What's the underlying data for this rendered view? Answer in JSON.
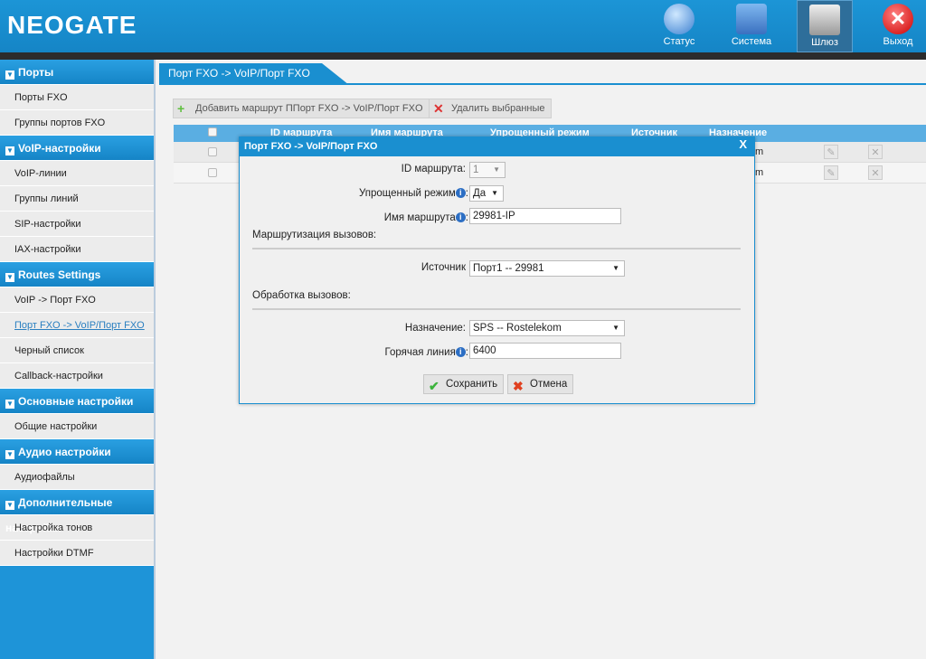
{
  "header": {
    "logo": "NEOGATE",
    "nav": [
      {
        "label": "Статус",
        "icon": "status-icon"
      },
      {
        "label": "Система",
        "icon": "system-icon"
      },
      {
        "label": "Шлюз",
        "icon": "gateway-icon",
        "active": true
      },
      {
        "label": "Выход",
        "icon": "logout-icon"
      }
    ]
  },
  "sidebar": {
    "sections": [
      {
        "title": "Порты",
        "items": [
          "Порты FXO",
          "Группы портов FXO"
        ]
      },
      {
        "title": "VoIP-настройки",
        "items": [
          "VoIP-линии",
          "Группы линий",
          "SIP-настройки",
          "IAX-настройки"
        ]
      },
      {
        "title": "Routes Settings",
        "items": [
          "VoIP -> Порт FXO",
          "Порт FXO -> VoIP/Порт FXO",
          "Черный список",
          "Callback-настройки"
        ]
      },
      {
        "title": "Основные настройки",
        "items": [
          "Общие настройки"
        ]
      },
      {
        "title": "Аудио настройки",
        "items": [
          "Аудиофайлы"
        ]
      },
      {
        "title": "Дополнительные настройки",
        "items": [
          "Настройка тонов",
          "Настройки DTMF"
        ]
      }
    ],
    "current": "Порт FXO -> VoIP/Порт FXO"
  },
  "main": {
    "tab": "Порт FXO -> VoIP/Порт FXO",
    "add_button": "Добавить маршрут ППорт FXO -> VoIP/Порт FXO",
    "delete_button": "Удалить выбранные",
    "columns": [
      "ID маршрута",
      "Имя маршрута",
      "Упрощенный режим",
      "Источник",
      "Назначение"
    ],
    "rows": [
      {
        "destination_visible": "m"
      },
      {
        "destination_visible": "m"
      }
    ]
  },
  "modal": {
    "title": "Порт FXO -> VoIP/Порт FXO",
    "close": "X",
    "route_id_label": "ID маршрута:",
    "route_id": "1",
    "simple_mode_label": "Упрощенный режим",
    "simple_mode": "Да",
    "route_name_label": "Имя маршрута",
    "route_name": "29981-IP",
    "call_routing": "Маршрутизация вызовов:",
    "source_label": "Источник",
    "source": "Порт1 -- 29981",
    "call_handling": "Обработка вызовов:",
    "destination_label": "Назначение:",
    "destination": "SPS -- Rostelekom",
    "hotline_label": "Горячая линия",
    "hotline": "6400",
    "save": "Сохранить",
    "cancel": "Отмена"
  },
  "colors": {
    "accent": "#1a8fd0",
    "dark_bar": "#2c2c2c"
  }
}
